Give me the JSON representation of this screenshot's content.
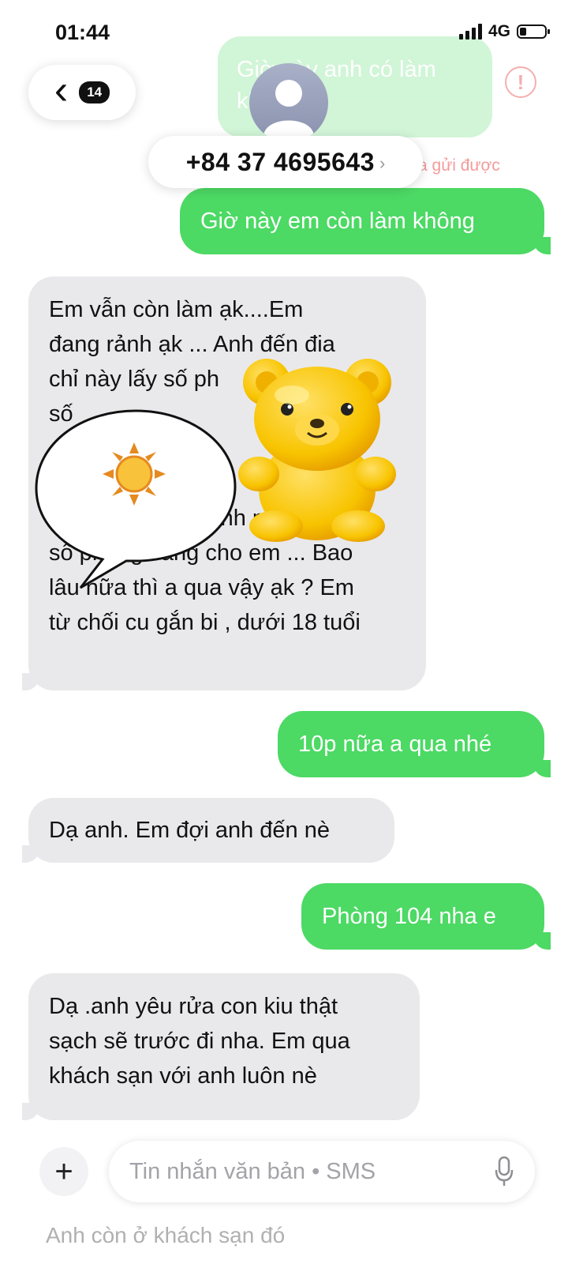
{
  "status": {
    "time": "01:44",
    "network": "4G"
  },
  "header": {
    "back_count": "14",
    "contact": "+84 37 4695643",
    "contact_chevron": "›"
  },
  "faded": {
    "text": "Giờ này anh có làm không",
    "error_mark": "!",
    "fail_text": "a gửi được"
  },
  "messages": [
    {
      "from": "me",
      "lines": [
        "Giờ này em còn làm không"
      ]
    },
    {
      "from": "them",
      "lines": [
        "Em vẫn còn làm ạk....Em",
        "đang rảnh ạk ... Anh đến đia",
        "chỉ này lấy số ph",
        "số",
        "",
        "",
        "Ng        ,.... Rồi anh nhắn tin",
        "số phòng sang cho em ... Bao",
        "lâu nữa thì a qua vậy ạk ? Em",
        "từ chối cu gắn bi , dưới 18 tuổi"
      ]
    },
    {
      "from": "me",
      "lines": [
        "10p nữa a qua nhé"
      ]
    },
    {
      "from": "them",
      "lines": [
        "Dạ anh. Em đợi anh đến nè"
      ]
    },
    {
      "from": "me",
      "lines": [
        "Phòng 104 nha e"
      ]
    },
    {
      "from": "them",
      "lines": [
        "Dạ .anh yêu rửa con kiu thật",
        "sạch sẽ trước đi nha. Em qua",
        "khách sạn với anh luôn nè"
      ]
    }
  ],
  "composer": {
    "plus": "+",
    "placeholder": "Tin nhắn văn bản • SMS"
  },
  "peek_text": "Anh còn ở khách sạn đó",
  "colors": {
    "sent": "#4cd964",
    "received": "#e9e9eb",
    "error": "#f07a7a"
  },
  "icons": [
    "chevron-left-icon",
    "person-icon",
    "error-icon",
    "plus-icon",
    "microphone-icon",
    "bear-sticker",
    "sun-speech-sticker"
  ]
}
